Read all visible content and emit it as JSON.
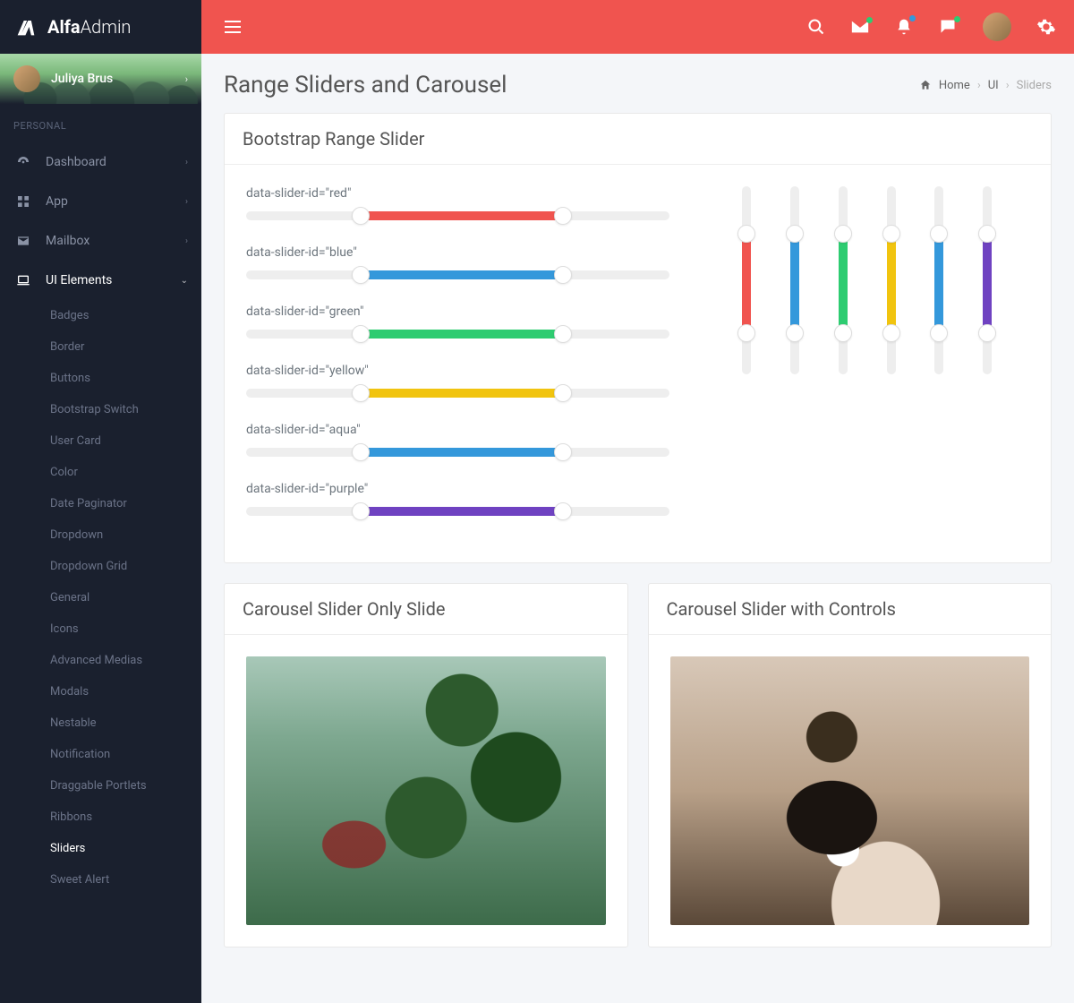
{
  "brand": {
    "bold": "Alfa",
    "light": "Admin"
  },
  "user": {
    "name": "Juliya Brus"
  },
  "menu_header": "PERSONAL",
  "menu": {
    "dashboard": "Dashboard",
    "app": "App",
    "mailbox": "Mailbox",
    "ui_elements": "UI Elements"
  },
  "submenu": {
    "badges": "Badges",
    "border": "Border",
    "buttons": "Buttons",
    "bootstrap_switch": "Bootstrap Switch",
    "user_card": "User Card",
    "color": "Color",
    "date_paginator": "Date Paginator",
    "dropdown": "Dropdown",
    "dropdown_grid": "Dropdown Grid",
    "general": "General",
    "icons": "Icons",
    "advanced_medias": "Advanced Medias",
    "modals": "Modals",
    "nestable": "Nestable",
    "notification": "Notification",
    "draggable_portlets": "Draggable Portlets",
    "ribbons": "Ribbons",
    "sliders": "Sliders",
    "sweet_alert": "Sweet Alert"
  },
  "page_title": "Range Sliders and Carousel",
  "breadcrumb": {
    "home": "Home",
    "ui": "UI",
    "sliders": "Sliders"
  },
  "cards": {
    "range_slider": "Bootstrap Range Slider",
    "carousel_only": "Carousel Slider Only Slide",
    "carousel_controls": "Carousel Slider with Controls"
  },
  "sliders": {
    "red": {
      "label": "data-slider-id=\"red\"",
      "lo": 27,
      "hi": 75,
      "color": "red"
    },
    "blue": {
      "label": "data-slider-id=\"blue\"",
      "lo": 27,
      "hi": 75,
      "color": "blue"
    },
    "green": {
      "label": "data-slider-id=\"green\"",
      "lo": 27,
      "hi": 75,
      "color": "green"
    },
    "yellow": {
      "label": "data-slider-id=\"yellow\"",
      "lo": 27,
      "hi": 75,
      "color": "yellow"
    },
    "aqua": {
      "label": "data-slider-id=\"aqua\"",
      "lo": 27,
      "hi": 75,
      "color": "aqua"
    },
    "purple": {
      "label": "data-slider-id=\"purple\"",
      "lo": 27,
      "hi": 75,
      "color": "purple"
    }
  },
  "v_sliders": [
    {
      "lo": 25,
      "hi": 78,
      "color": "red"
    },
    {
      "lo": 25,
      "hi": 78,
      "color": "blue"
    },
    {
      "lo": 25,
      "hi": 78,
      "color": "green"
    },
    {
      "lo": 25,
      "hi": 78,
      "color": "yellow"
    },
    {
      "lo": 25,
      "hi": 78,
      "color": "aqua"
    },
    {
      "lo": 25,
      "hi": 78,
      "color": "purple"
    }
  ]
}
